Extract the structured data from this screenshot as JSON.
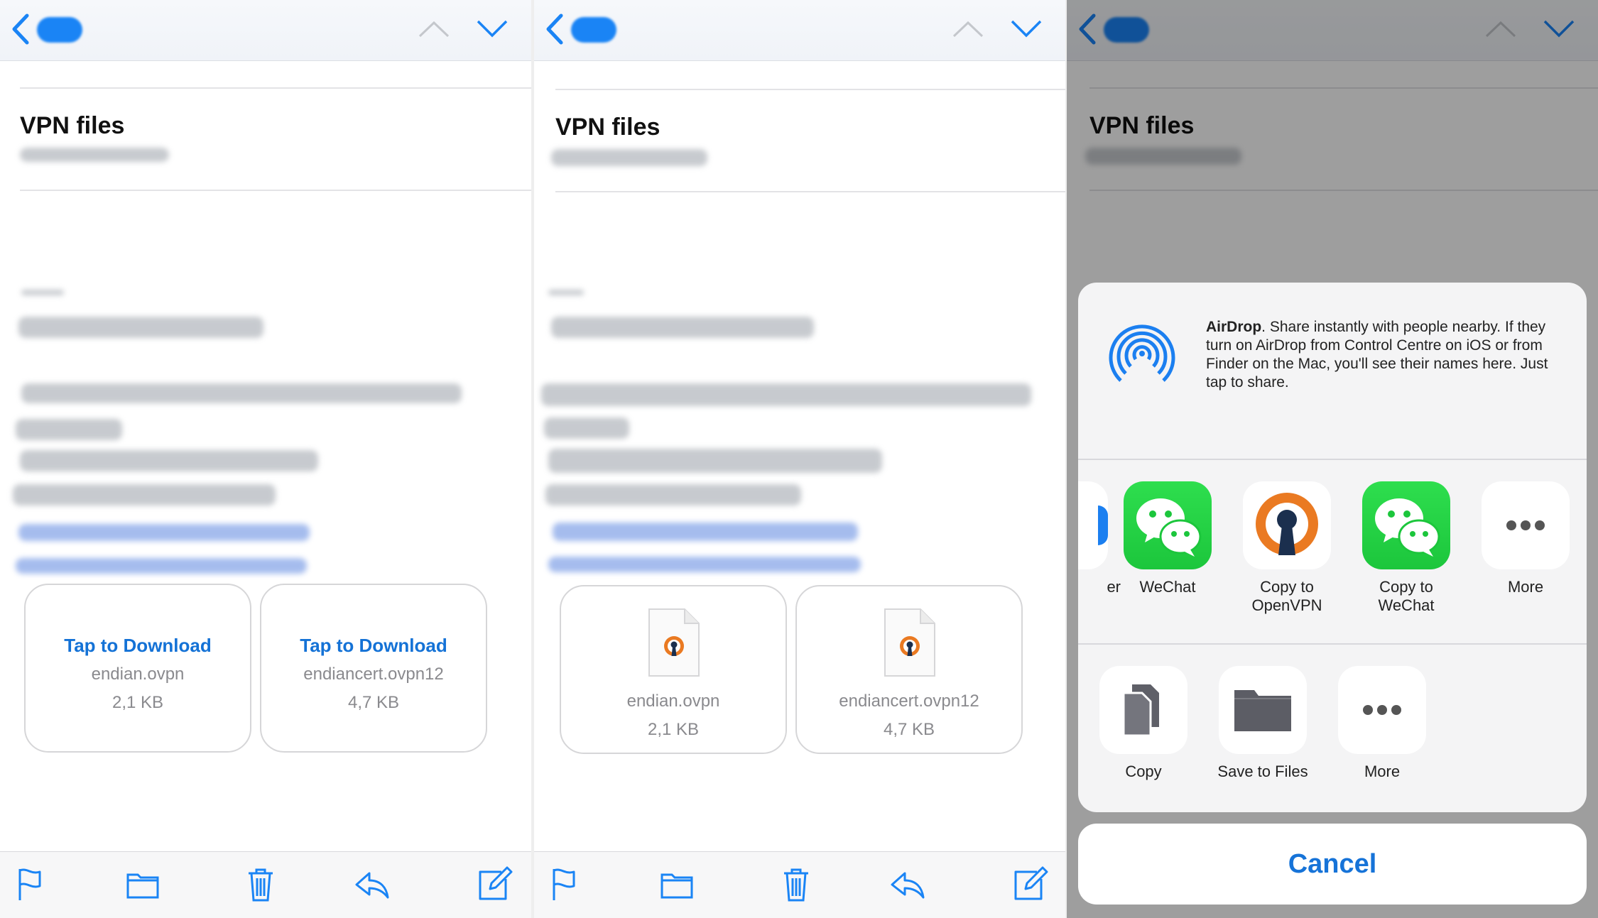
{
  "mail": {
    "subject": "VPN files",
    "attachments": [
      {
        "action": "Tap to Download",
        "name": "endian.ovpn",
        "size": "2,1 KB"
      },
      {
        "action": "Tap to Download",
        "name": "endiancert.ovpn12",
        "size": "4,7 KB"
      }
    ]
  },
  "toolbar": {
    "icons": [
      "flag-icon",
      "folder-icon",
      "trash-icon",
      "reply-icon",
      "compose-icon"
    ]
  },
  "share_sheet": {
    "airdrop": {
      "title": "AirDrop",
      "text": ". Share instantly with people nearby. If they turn on AirDrop from Control Centre on iOS or from Finder on the Mac, you'll see their names here. Just tap to share."
    },
    "apps": [
      {
        "label": "er"
      },
      {
        "label": "WeChat"
      },
      {
        "label": "Copy to OpenVPN"
      },
      {
        "label": "Copy to WeChat"
      },
      {
        "label": "More"
      }
    ],
    "actions": [
      {
        "label": "Copy"
      },
      {
        "label": "Save to Files"
      },
      {
        "label": "More"
      }
    ],
    "cancel": "Cancel"
  },
  "colors": {
    "accent": "#1673d8",
    "wechat": "#1cc63c",
    "openvpn_orange": "#ea7a22",
    "airdrop": "#1b7ff0"
  }
}
